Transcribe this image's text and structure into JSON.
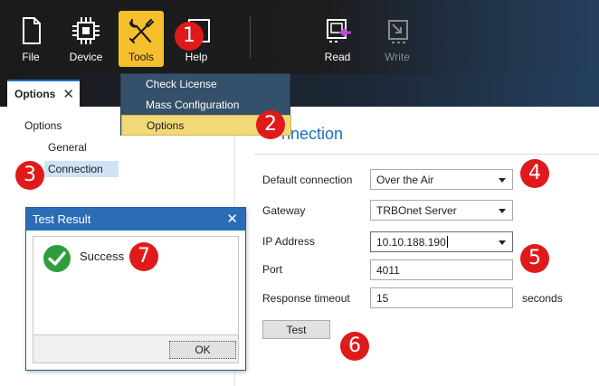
{
  "toolbar": {
    "file_label": "File",
    "device_label": "Device",
    "tools_label": "Tools",
    "help_label": "Help",
    "read_label": "Read",
    "write_label": "Write"
  },
  "tools_menu": {
    "items": [
      "Check License",
      "Mass Configuration",
      "Options"
    ],
    "selected": "Options"
  },
  "tab": {
    "label": "Options",
    "close": "✕"
  },
  "tree": {
    "root": "Options",
    "children": [
      "General",
      "Connection"
    ],
    "selected": "Connection"
  },
  "panel": {
    "title": "nnection",
    "default_connection": {
      "label": "Default connection",
      "value": "Over the Air"
    },
    "gateway": {
      "label": "Gateway",
      "value": "TRBOnet Server"
    },
    "ip_address": {
      "label": "IP Address",
      "value": "10.10.188.190"
    },
    "port": {
      "label": "Port",
      "value": "4011"
    },
    "response_timeout": {
      "label": "Response timeout",
      "value": "15",
      "unit": "seconds"
    },
    "test_button": "Test"
  },
  "dialog": {
    "title": "Test Result",
    "close": "✕",
    "message": "Success",
    "ok_button": "OK"
  },
  "badges": [
    "1",
    "2",
    "3",
    "4",
    "5",
    "6",
    "7"
  ],
  "colors": {
    "accent": "#1f6fbf",
    "tools_active": "#f5bf2c",
    "menu_bg": "#35506a",
    "menu_selected": "#f2d978",
    "badge": "#e01a1a",
    "success_green": "#2e9e3c"
  }
}
